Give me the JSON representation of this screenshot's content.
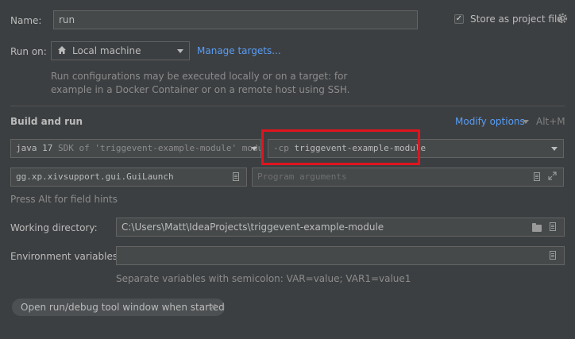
{
  "name": {
    "label": "Name:",
    "value": "run"
  },
  "store": {
    "label": "Store as project file",
    "checked": true
  },
  "run_on": {
    "label": "Run on:",
    "value": "Local machine",
    "link": "Manage targets...",
    "hint_line1": "Run configurations may be executed locally or on a target: for",
    "hint_line2": "example in a Docker Container or on a remote host using SSH."
  },
  "build": {
    "title": "Build and run",
    "modify_label": "Modify options",
    "modify_shortcut": "Alt+M",
    "jdk_version": "java 17",
    "jdk_desc": "SDK of 'triggevent-example-module' modul",
    "classpath_prefix": "-cp",
    "classpath_value": "triggevent-example-module",
    "main_class": "gg.xp.xivsupport.gui.GuiLaunch",
    "program_args_placeholder": "Program arguments",
    "field_hint": "Press Alt for field hints"
  },
  "working_dir": {
    "label": "Working directory:",
    "value": "C:\\Users\\Matt\\IdeaProjects\\triggevent-example-module"
  },
  "env": {
    "label": "Environment variables:",
    "value": "",
    "hint": "Separate variables with semicolon: VAR=value; VAR1=value1"
  },
  "chip": {
    "label": "Open run/debug tool window when started"
  },
  "colors": {
    "background": "#3c3f41",
    "field": "#45494a",
    "link": "#589df6",
    "highlight": "#e0141e"
  }
}
